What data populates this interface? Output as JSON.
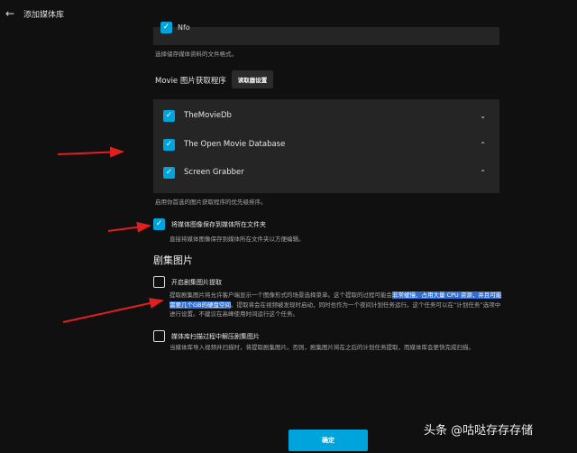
{
  "header": {
    "title": "添加媒体库",
    "back_icon": "arrow-left-icon"
  },
  "format_section": {
    "item_label": "Nfo",
    "hint": "选择储存媒体资料的文件格式。"
  },
  "image_fetchers": {
    "label": "Movie 图片获取程序",
    "settings_button": "读取器设置",
    "items": [
      {
        "label": "TheMovieDb",
        "chevron": "chevron-down-icon"
      },
      {
        "label": "The Open Movie Database",
        "chevron": "chevron-up-icon"
      },
      {
        "label": "Screen Grabber",
        "chevron": "chevron-up-icon"
      }
    ],
    "hint": "启用你首选的图片获取程序的优先级排序。"
  },
  "save_images": {
    "label": "将媒体图像保存到媒体所在文件夹",
    "hint": "直接将媒体图像保存到媒体所在文件夹以方便编辑。"
  },
  "episode_images": {
    "heading": "剧集图片",
    "enable_extraction": {
      "label": "开启剧集图片提取",
      "desc_before": "提取剧集图片将允许客户端显示一个图像形式的场景选择菜单。这个提取的过程可能会",
      "desc_highlight": "非常缓慢、占用大量 CPU 资源，并且可能需要几个GB的硬盘空间",
      "desc_after": "。提取将会在视频被发现时启动，同时也作为一个夜间计划任务运行。这个任务可以在“计划任务”选项中进行设置。不建议在高峰使用时间运行这个任务。"
    },
    "extract_during_scan": {
      "label": "媒体库扫描过程中解压剧集图片",
      "desc": "当媒体库导入视频并扫描时，将提取剧集图片。否则，剧集图片将在之后的计划任务提取，而媒体库会更快完成扫描。"
    }
  },
  "footer": {
    "ok_button": "确定"
  },
  "watermark": "头条 @咕哒存存存储",
  "colors": {
    "accent": "#00a4dc",
    "panel": "#252525",
    "background": "#101010",
    "highlight": "#2f6fd6",
    "annotation_arrow": "#e02020"
  }
}
